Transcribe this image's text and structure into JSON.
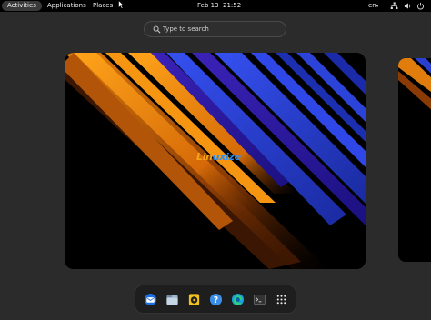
{
  "topbar": {
    "activities": "Activities",
    "applications": "Applications",
    "places": "Places",
    "date": "Feb 13",
    "time": "21:52",
    "language": "en",
    "tray_icons": [
      "network-icon",
      "volume-icon",
      "power-icon"
    ]
  },
  "search": {
    "placeholder": "Type to search",
    "icon": "search-icon"
  },
  "workspace": {
    "logo_part1": "Lin",
    "logo_part2": "uxize"
  },
  "dock": {
    "apps": [
      "thunderbird-icon",
      "files-icon",
      "rhythmbox-icon",
      "help-icon",
      "edge-icon",
      "terminal-icon",
      "app-grid-icon"
    ]
  },
  "colors": {
    "topbar_bg": "#000000",
    "stripe_orange": "#f08a10",
    "stripe_blue": "#2a3fe0",
    "stripe_purple": "#3a2fbf"
  }
}
